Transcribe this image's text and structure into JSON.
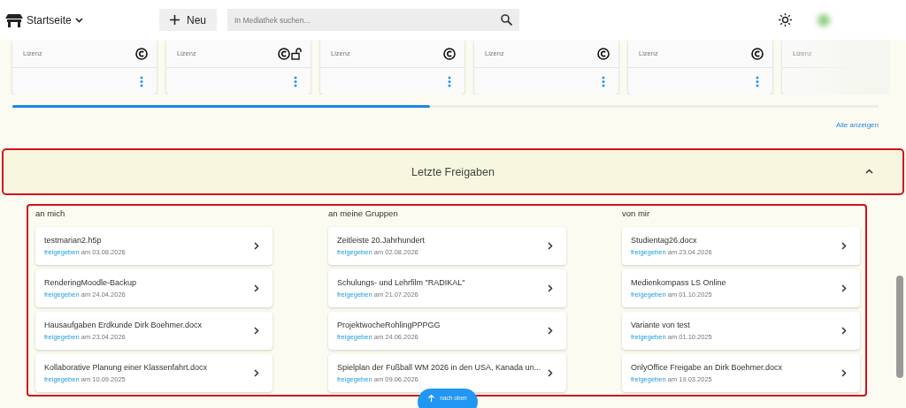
{
  "header": {
    "home_label": "Startseite",
    "new_button": "Neu",
    "search": {
      "placeholder": "In Mediathek suchen..."
    }
  },
  "media_cards": [
    {
      "kind": "copyright",
      "license_label": "Lizenz",
      "menu": true
    },
    {
      "kind": "open",
      "license_label": "Lizenz",
      "menu": true
    },
    {
      "kind": "copyright",
      "license_label": "Lizenz",
      "menu": true
    },
    {
      "kind": "copyright",
      "license_label": "Lizenz",
      "menu": true
    },
    {
      "kind": "copyright",
      "license_label": "Lizenz",
      "menu": true
    },
    {
      "kind": "plain",
      "license_label": "Lizenz",
      "menu": false
    }
  ],
  "show_all_link": "Alle anzeigen",
  "shares": {
    "title": "Letzte Freigaben",
    "expanded": true,
    "columns": [
      {
        "heading": "an mich",
        "items": [
          {
            "name": "testmarian2.h5p",
            "status": "freigegeben",
            "date": "am 03.08.2026"
          },
          {
            "name": "RenderingMoodle-Backup",
            "status": "freigegeben",
            "date": "am 24.04.2026"
          },
          {
            "name": "Hausaufgaben Erdkunde Dirk Boehmer.docx",
            "status": "freigegeben",
            "date": "am 23.04.2026"
          },
          {
            "name": "Kollaborative Planung einer Klassenfahrt.docx",
            "status": "freigegeben",
            "date": "am 10.09.2025"
          }
        ]
      },
      {
        "heading": "an meine Gruppen",
        "items": [
          {
            "name": "Zeitleiste 20.Jahrhundert",
            "status": "freigegeben",
            "date": "am 02.08.2026"
          },
          {
            "name": "Schulungs- und Lehrfilm \"RADIKAL\"",
            "status": "freigegeben",
            "date": "am 21.07.2026"
          },
          {
            "name": "ProjektwocheRohlingPPPGG",
            "status": "freigegeben",
            "date": "am 24.06.2026"
          },
          {
            "name": "Spielplan der Fußball WM 2026 in den USA, Kanada un...",
            "status": "freigegeben",
            "date": "am 09.06.2026"
          }
        ]
      },
      {
        "heading": "von mir",
        "items": [
          {
            "name": "Studientag26.docx",
            "status": "freigegeben",
            "date": "am 23.04.2026"
          },
          {
            "name": "Medienkompass LS Online",
            "status": "freigegeben",
            "date": "am 01.10.2025"
          },
          {
            "name": "Variante von test",
            "status": "freigegeben",
            "date": "am 01.10.2025"
          },
          {
            "name": "OnlyOffice Freigabe an Dirk Boehmer.docx",
            "status": "freigegeben",
            "date": "am 19.03.2025"
          }
        ]
      }
    ]
  },
  "back_to_top": "nach oben"
}
